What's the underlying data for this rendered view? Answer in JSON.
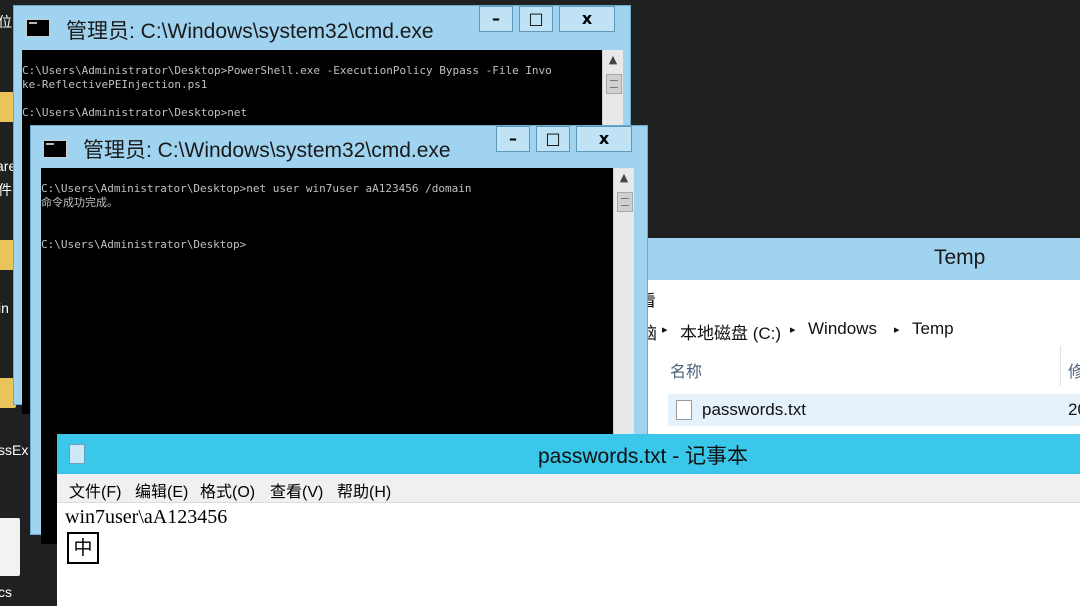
{
  "desktop": {
    "labels": [
      "位",
      "are",
      "件",
      "in",
      "ssEx",
      "cs"
    ]
  },
  "cmd_back": {
    "title": "管理员: C:\\Windows\\system32\\cmd.exe",
    "minimize": "–",
    "maximize": "□",
    "close": "x",
    "lines": [
      "C:\\Users\\Administrator\\Desktop>PowerShell.exe -ExecutionPolicy Bypass -File Invo",
      "ke-ReflectivePEInjection.ps1",
      "",
      "C:\\Users\\Administrator\\Desktop>net"
    ]
  },
  "cmd_front": {
    "title": "管理员: C:\\Windows\\system32\\cmd.exe",
    "minimize": "–",
    "maximize": "□",
    "close": "x",
    "lines": [
      "C:\\Users\\Administrator\\Desktop>net user win7user aA123456 /domain",
      "命令成功完成。",
      "",
      "",
      "C:\\Users\\Administrator\\Desktop>"
    ]
  },
  "explorer": {
    "title": "Temp",
    "ribbon_fragment": "看",
    "breadcrumb_lead": "脑",
    "breadcrumb": [
      "本地磁盘 (C:)",
      "Windows",
      "Temp"
    ],
    "column_name": "名称",
    "column_modified": "修",
    "file_name": "passwords.txt",
    "file_modified": "20"
  },
  "notepad": {
    "title": "passwords.txt - 记事本",
    "menu": [
      "文件(F)",
      "编辑(E)",
      "格式(O)",
      "查看(V)",
      "帮助(H)"
    ],
    "content": "win7user\\aA123456",
    "ime_indicator": "中"
  },
  "colors": {
    "title_inactive": "#9fd3ef",
    "title_active": "#3bc7ea",
    "console_bg": "#000000",
    "console_text": "#c0c0c0"
  }
}
